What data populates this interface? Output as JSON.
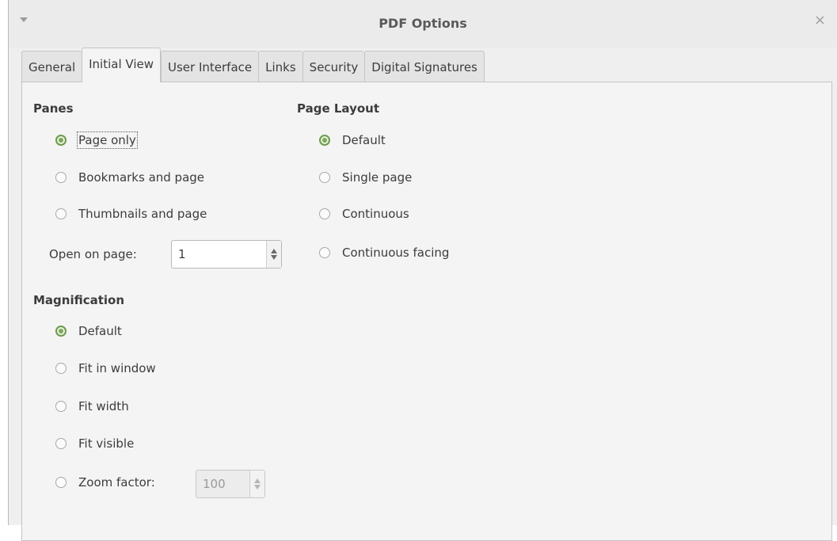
{
  "window": {
    "title": "PDF Options",
    "close_glyph": "×"
  },
  "tabs": [
    {
      "label": "General",
      "active": false
    },
    {
      "label": "Initial View",
      "active": true
    },
    {
      "label": "User Interface",
      "active": false
    },
    {
      "label": "Links",
      "active": false
    },
    {
      "label": "Security",
      "active": false
    },
    {
      "label": "Digital Signatures",
      "active": false
    }
  ],
  "panes": {
    "heading": "Panes",
    "options": [
      {
        "label": "Page only",
        "checked": true
      },
      {
        "label": "Bookmarks and page",
        "checked": false
      },
      {
        "label": "Thumbnails and page",
        "checked": false
      }
    ],
    "open_on_page_label": "Open on page:",
    "open_on_page_value": "1"
  },
  "page_layout": {
    "heading": "Page Layout",
    "options": [
      {
        "label": "Default",
        "checked": true
      },
      {
        "label": "Single page",
        "checked": false
      },
      {
        "label": "Continuous",
        "checked": false
      },
      {
        "label": "Continuous facing",
        "checked": false
      }
    ]
  },
  "magnification": {
    "heading": "Magnification",
    "options": [
      {
        "label": "Default",
        "checked": true
      },
      {
        "label": "Fit in window",
        "checked": false
      },
      {
        "label": "Fit width",
        "checked": false
      },
      {
        "label": "Fit visible",
        "checked": false
      },
      {
        "label": "Zoom factor:",
        "checked": false
      }
    ],
    "zoom_value": "100"
  },
  "colors": {
    "accent_green": "#6d9a4e",
    "panel_bg": "#f4f4f4",
    "window_bg": "#efefef"
  },
  "icons": {
    "title_menu": "window-menu-icon",
    "close": "close-icon"
  }
}
